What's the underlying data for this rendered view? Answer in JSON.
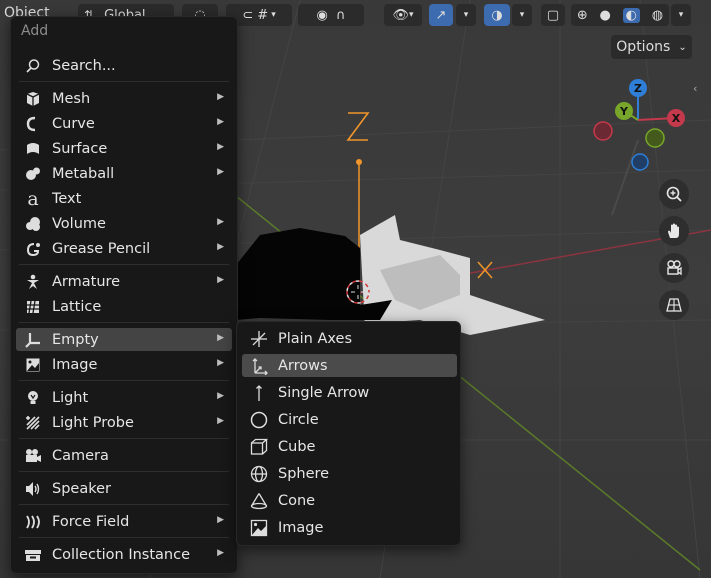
{
  "header": {
    "mode_label": "Object",
    "orientation_label": "Global",
    "options_label": "Options"
  },
  "gizmo": {
    "x": "X",
    "y": "Y",
    "z": "Z"
  },
  "add_menu": {
    "title": "Add",
    "items": [
      {
        "label": "Search...",
        "icon": "search-icon"
      },
      {
        "label": "Mesh",
        "icon": "mesh-icon",
        "submenu": true
      },
      {
        "label": "Curve",
        "icon": "curve-icon",
        "submenu": true
      },
      {
        "label": "Surface",
        "icon": "surface-icon",
        "submenu": true
      },
      {
        "label": "Metaball",
        "icon": "metaball-icon",
        "submenu": true
      },
      {
        "label": "Text",
        "icon": "text-icon"
      },
      {
        "label": "Volume",
        "icon": "volume-icon",
        "submenu": true
      },
      {
        "label": "Grease Pencil",
        "icon": "grease-pencil-icon",
        "submenu": true
      },
      {
        "label": "Armature",
        "icon": "armature-icon",
        "submenu": true
      },
      {
        "label": "Lattice",
        "icon": "lattice-icon"
      },
      {
        "label": "Empty",
        "icon": "empty-icon",
        "submenu": true,
        "highlighted": true
      },
      {
        "label": "Image",
        "icon": "image-icon",
        "submenu": true
      },
      {
        "label": "Light",
        "icon": "light-icon",
        "submenu": true
      },
      {
        "label": "Light Probe",
        "icon": "light-probe-icon",
        "submenu": true
      },
      {
        "label": "Camera",
        "icon": "camera-icon"
      },
      {
        "label": "Speaker",
        "icon": "speaker-icon"
      },
      {
        "label": "Force Field",
        "icon": "force-field-icon",
        "submenu": true
      },
      {
        "label": "Collection Instance",
        "icon": "collection-instance-icon",
        "submenu": true
      }
    ]
  },
  "empty_submenu": {
    "items": [
      {
        "label": "Plain Axes",
        "icon": "plain-axes-icon"
      },
      {
        "label": "Arrows",
        "icon": "arrows-icon",
        "highlighted": true
      },
      {
        "label": "Single Arrow",
        "icon": "single-arrow-icon"
      },
      {
        "label": "Circle",
        "icon": "circle-icon"
      },
      {
        "label": "Cube",
        "icon": "cube-icon"
      },
      {
        "label": "Sphere",
        "icon": "sphere-icon"
      },
      {
        "label": "Cone",
        "icon": "cone-icon"
      },
      {
        "label": "Image",
        "icon": "image-icon"
      }
    ]
  },
  "colors": {
    "accent": "#3d6bb0",
    "x_axis": "#c4394b",
    "y_axis": "#78a62a",
    "z_axis": "#2f7fd9",
    "empty_orange": "#f0962a"
  }
}
